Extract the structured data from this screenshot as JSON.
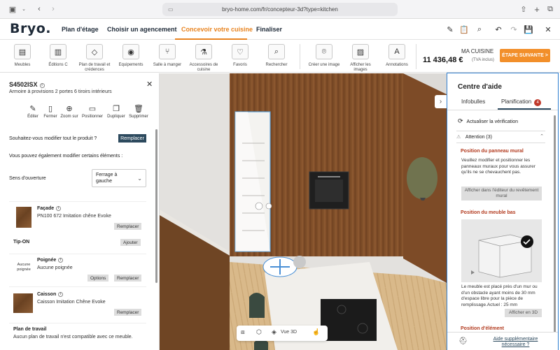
{
  "browser": {
    "url": "bryo-home.com/fr/concepteur-3d?type=kitchen"
  },
  "header": {
    "logo": "Bryo.",
    "tabs": [
      "Plan d'étage",
      "Choisir un agencement",
      "Concevoir votre cuisine",
      "Finaliser"
    ],
    "active_tab": "Concevoir votre cuisine"
  },
  "toolbar": {
    "tools": [
      "Meubles",
      "Éditions C",
      "Plan de travail et crédences",
      "Equipements",
      "Salle à manger",
      "Accessoires de cuisine",
      "Favoris",
      "Rechercher",
      "Créer une image",
      "Afficher les images",
      "Annotations"
    ],
    "cart_label": "MA CUISINE",
    "cart_total": "11 436,48 €",
    "cart_tva": "(TVA inclus)",
    "next_button": "ÉTAPE SUIVANTE >"
  },
  "product_panel": {
    "code": "S4502ISX",
    "description": "Armoire à provisions 2 portes 6 tiroirs intérieurs",
    "actions": [
      "Éditer",
      "Fermer",
      "Zoom sur",
      "Positionner",
      "Dupliquer",
      "Supprimer"
    ],
    "replace_question": "Souhaitez-vous modifier tout le produit ?",
    "replace_button": "Remplacer",
    "modify_elements": "Vous pouvez également modifier certains éléments :",
    "opening_label": "Sens d'ouverture",
    "opening_value": "Ferrage à gauche",
    "facade": {
      "title": "Façade",
      "value": "PN100 672 Imitation chêne Evoke",
      "button": "Remplacer"
    },
    "tipon": {
      "title": "Tip-ON",
      "button": "Ajouter"
    },
    "handle": {
      "title": "Poignée",
      "value": "Aucune poignée",
      "thumb": "Aucune poignée",
      "button_options": "Options",
      "button_replace": "Remplacer"
    },
    "carcass": {
      "title": "Caisson",
      "value": "Caisson Imitation Chêne Evoke",
      "button": "Remplacer"
    },
    "worktop": {
      "title": "Plan de travail",
      "value": "Aucun plan de travail n'est compatible avec ce meuble."
    }
  },
  "scene": {
    "view_label": "Vue 3D"
  },
  "help_panel": {
    "title": "Centre d'aide",
    "tabs": [
      "Infobulles",
      "Planification"
    ],
    "active_tab": "Planification",
    "badge": "4",
    "refresh": "Actualiser la vérification",
    "attention": "Attention (3)",
    "issues": [
      {
        "title": "Position du panneau mural",
        "text": "Veuillez modifier et positionner les panneaux muraux pour vous assurer qu'ils ne se chevauchent pas.",
        "button": "Afficher dans l'éditeur du revêtement mural"
      },
      {
        "title": "Position du meuble bas",
        "text": "Le meuble est placé près d'un mur ou d'un obstacle ayant moins de 30 mm d'espace libre pour la pièce de remplissage.Actuel : 25 mm",
        "button": "Afficher en 3D"
      },
      {
        "title": "Position d'élément"
      }
    ],
    "footer_link": "Aide supplémentaire nécessaire ?"
  },
  "colors": {
    "accent": "#e8831f",
    "dark": "#2d4a5e",
    "focus_border": "#2f7fd1",
    "issue_title": "#b23a1e"
  }
}
